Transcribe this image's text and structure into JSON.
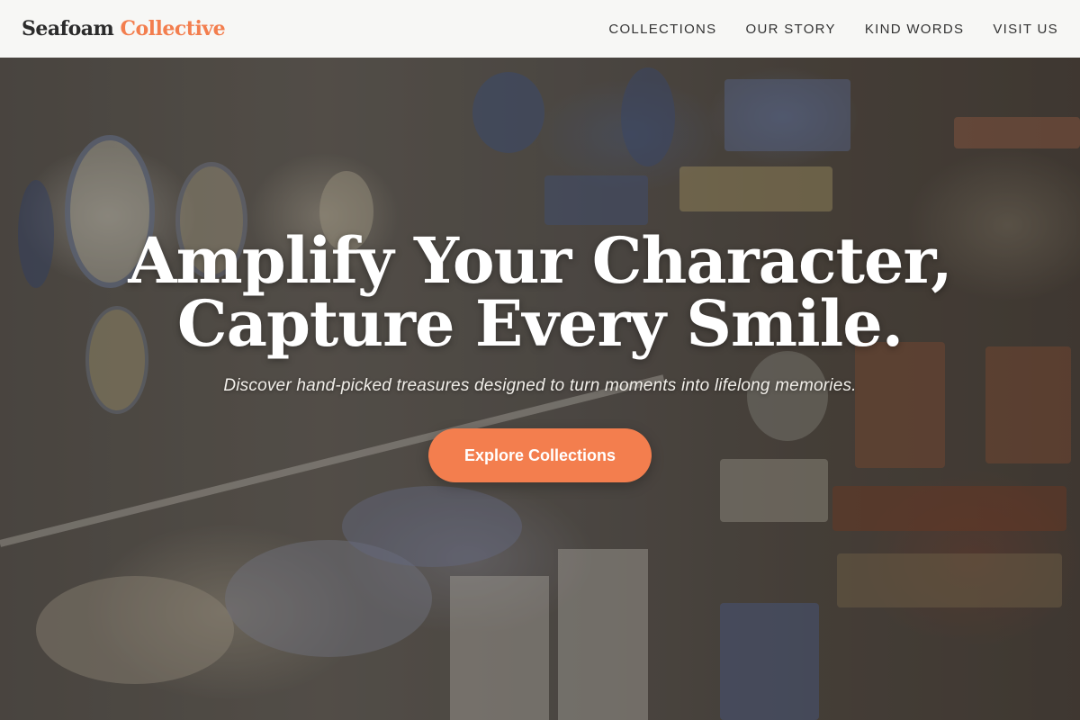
{
  "brand": {
    "name_part1": "Seafoam",
    "name_part2": "Collective",
    "accent_color": "#f37e4e"
  },
  "nav": {
    "items": [
      {
        "label": "COLLECTIONS"
      },
      {
        "label": "OUR STORY"
      },
      {
        "label": "KIND WORDS"
      },
      {
        "label": "VISIT US"
      }
    ]
  },
  "hero": {
    "headline_line1": "Amplify Your Character,",
    "headline_line2": "Capture Every Smile.",
    "subtitle": "Discover hand-picked treasures designed to turn moments into lifelong memories.",
    "cta_label": "Explore Collections"
  }
}
